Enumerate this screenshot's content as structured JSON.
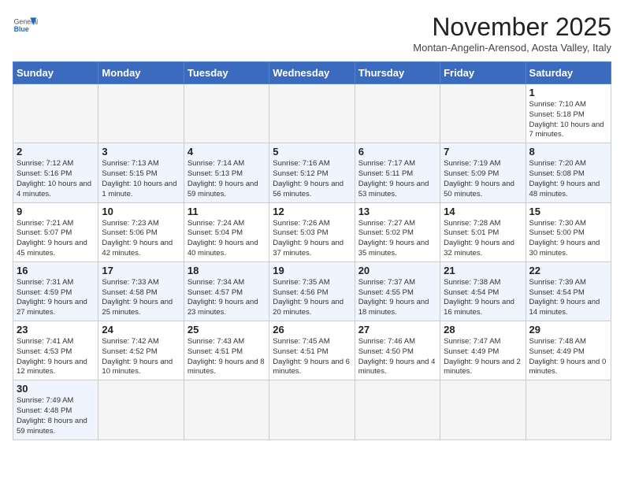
{
  "header": {
    "logo_general": "General",
    "logo_blue": "Blue",
    "month": "November 2025",
    "location": "Montan-Angelin-Arensod, Aosta Valley, Italy"
  },
  "weekdays": [
    "Sunday",
    "Monday",
    "Tuesday",
    "Wednesday",
    "Thursday",
    "Friday",
    "Saturday"
  ],
  "weeks": [
    [
      {
        "day": "",
        "info": ""
      },
      {
        "day": "",
        "info": ""
      },
      {
        "day": "",
        "info": ""
      },
      {
        "day": "",
        "info": ""
      },
      {
        "day": "",
        "info": ""
      },
      {
        "day": "",
        "info": ""
      },
      {
        "day": "1",
        "info": "Sunrise: 7:10 AM\nSunset: 5:18 PM\nDaylight: 10 hours and 7 minutes."
      }
    ],
    [
      {
        "day": "2",
        "info": "Sunrise: 7:12 AM\nSunset: 5:16 PM\nDaylight: 10 hours and 4 minutes."
      },
      {
        "day": "3",
        "info": "Sunrise: 7:13 AM\nSunset: 5:15 PM\nDaylight: 10 hours and 1 minute."
      },
      {
        "day": "4",
        "info": "Sunrise: 7:14 AM\nSunset: 5:13 PM\nDaylight: 9 hours and 59 minutes."
      },
      {
        "day": "5",
        "info": "Sunrise: 7:16 AM\nSunset: 5:12 PM\nDaylight: 9 hours and 56 minutes."
      },
      {
        "day": "6",
        "info": "Sunrise: 7:17 AM\nSunset: 5:11 PM\nDaylight: 9 hours and 53 minutes."
      },
      {
        "day": "7",
        "info": "Sunrise: 7:19 AM\nSunset: 5:09 PM\nDaylight: 9 hours and 50 minutes."
      },
      {
        "day": "8",
        "info": "Sunrise: 7:20 AM\nSunset: 5:08 PM\nDaylight: 9 hours and 48 minutes."
      }
    ],
    [
      {
        "day": "9",
        "info": "Sunrise: 7:21 AM\nSunset: 5:07 PM\nDaylight: 9 hours and 45 minutes."
      },
      {
        "day": "10",
        "info": "Sunrise: 7:23 AM\nSunset: 5:06 PM\nDaylight: 9 hours and 42 minutes."
      },
      {
        "day": "11",
        "info": "Sunrise: 7:24 AM\nSunset: 5:04 PM\nDaylight: 9 hours and 40 minutes."
      },
      {
        "day": "12",
        "info": "Sunrise: 7:26 AM\nSunset: 5:03 PM\nDaylight: 9 hours and 37 minutes."
      },
      {
        "day": "13",
        "info": "Sunrise: 7:27 AM\nSunset: 5:02 PM\nDaylight: 9 hours and 35 minutes."
      },
      {
        "day": "14",
        "info": "Sunrise: 7:28 AM\nSunset: 5:01 PM\nDaylight: 9 hours and 32 minutes."
      },
      {
        "day": "15",
        "info": "Sunrise: 7:30 AM\nSunset: 5:00 PM\nDaylight: 9 hours and 30 minutes."
      }
    ],
    [
      {
        "day": "16",
        "info": "Sunrise: 7:31 AM\nSunset: 4:59 PM\nDaylight: 9 hours and 27 minutes."
      },
      {
        "day": "17",
        "info": "Sunrise: 7:33 AM\nSunset: 4:58 PM\nDaylight: 9 hours and 25 minutes."
      },
      {
        "day": "18",
        "info": "Sunrise: 7:34 AM\nSunset: 4:57 PM\nDaylight: 9 hours and 23 minutes."
      },
      {
        "day": "19",
        "info": "Sunrise: 7:35 AM\nSunset: 4:56 PM\nDaylight: 9 hours and 20 minutes."
      },
      {
        "day": "20",
        "info": "Sunrise: 7:37 AM\nSunset: 4:55 PM\nDaylight: 9 hours and 18 minutes."
      },
      {
        "day": "21",
        "info": "Sunrise: 7:38 AM\nSunset: 4:54 PM\nDaylight: 9 hours and 16 minutes."
      },
      {
        "day": "22",
        "info": "Sunrise: 7:39 AM\nSunset: 4:54 PM\nDaylight: 9 hours and 14 minutes."
      }
    ],
    [
      {
        "day": "23",
        "info": "Sunrise: 7:41 AM\nSunset: 4:53 PM\nDaylight: 9 hours and 12 minutes."
      },
      {
        "day": "24",
        "info": "Sunrise: 7:42 AM\nSunset: 4:52 PM\nDaylight: 9 hours and 10 minutes."
      },
      {
        "day": "25",
        "info": "Sunrise: 7:43 AM\nSunset: 4:51 PM\nDaylight: 9 hours and 8 minutes."
      },
      {
        "day": "26",
        "info": "Sunrise: 7:45 AM\nSunset: 4:51 PM\nDaylight: 9 hours and 6 minutes."
      },
      {
        "day": "27",
        "info": "Sunrise: 7:46 AM\nSunset: 4:50 PM\nDaylight: 9 hours and 4 minutes."
      },
      {
        "day": "28",
        "info": "Sunrise: 7:47 AM\nSunset: 4:49 PM\nDaylight: 9 hours and 2 minutes."
      },
      {
        "day": "29",
        "info": "Sunrise: 7:48 AM\nSunset: 4:49 PM\nDaylight: 9 hours and 0 minutes."
      }
    ],
    [
      {
        "day": "30",
        "info": "Sunrise: 7:49 AM\nSunset: 4:48 PM\nDaylight: 8 hours and 59 minutes."
      },
      {
        "day": "",
        "info": ""
      },
      {
        "day": "",
        "info": ""
      },
      {
        "day": "",
        "info": ""
      },
      {
        "day": "",
        "info": ""
      },
      {
        "day": "",
        "info": ""
      },
      {
        "day": "",
        "info": ""
      }
    ]
  ]
}
